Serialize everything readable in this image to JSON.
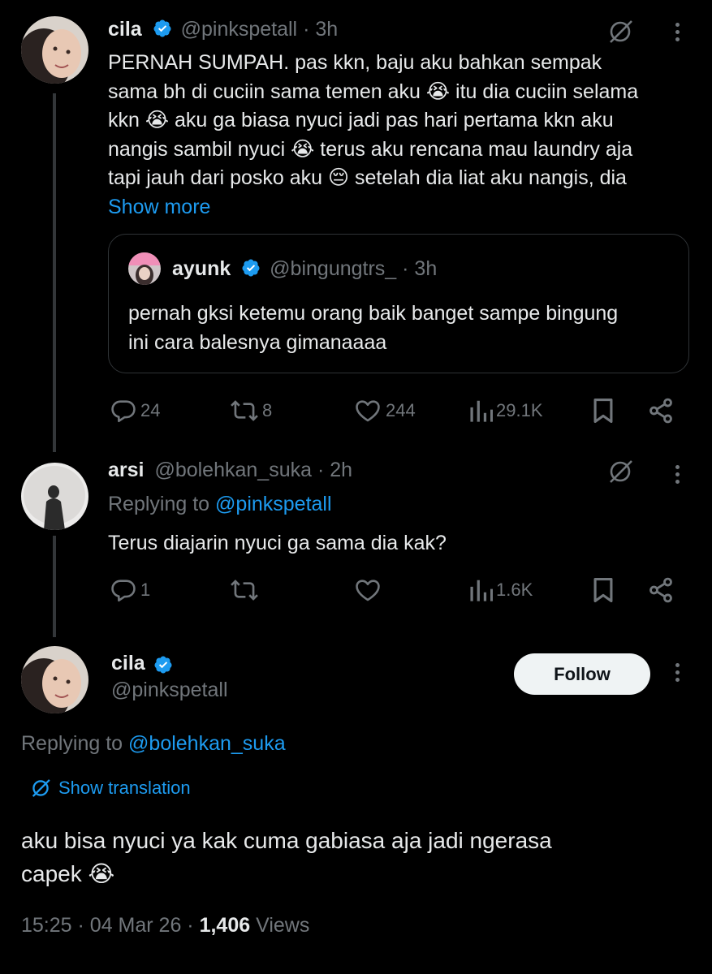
{
  "tweet1": {
    "display_name": "cila",
    "handle": "@pinkspetall",
    "dot_time": "· 3h",
    "lines": [
      "PERNAH SUMPAH. pas kkn, baju aku bahkan sempak",
      "sama bh di cuciin sama temen aku 😭 itu dia cuciin selama",
      "kkn 😭 aku ga biasa nyuci jadi pas hari pertama kkn aku",
      "nangis sambil nyuci 😭 terus aku rencana mau laundry aja",
      "tapi jauh dari posko aku 😔 setelah dia liat aku nangis, dia"
    ],
    "show_more": "Show more",
    "quote": {
      "display_name": "ayunk",
      "handle": "@bingungtrs_",
      "dot_time": "· 3h",
      "lines": [
        "pernah gksi ketemu orang baik banget sampe bingung",
        "ini cara balesnya gimanaaaa"
      ]
    },
    "stats": {
      "replies": "24",
      "reposts": "8",
      "likes": "244",
      "views": "29.1K"
    }
  },
  "tweet2": {
    "display_name": "arsi",
    "handle": "@bolehkan_suka",
    "dot_time": "· 2h",
    "replying_prefix": "Replying to",
    "replying_handle": "@pinkspetall",
    "text": "Terus diajarin nyuci ga sama dia kak?",
    "stats": {
      "replies": "1",
      "reposts": "",
      "likes": "",
      "views": "1.6K"
    }
  },
  "tweet3": {
    "display_name": "cila",
    "handle": "@pinkspetall",
    "follow_label": "Follow",
    "replying_prefix": "Replying to",
    "replying_handle": "@bolehkan_suka",
    "show_translation": "Show translation",
    "lines": [
      "aku bisa nyuci ya kak cuma gabiasa aja jadi ngerasa",
      "capek 😭"
    ],
    "time": "15:25",
    "date": "· 04 Mar 26 ·",
    "views_count": "1,406",
    "views_label": "Views"
  },
  "colors": {
    "background": "#000000",
    "text": "#e7e9ea",
    "muted": "#71767b",
    "accent": "#1d9bf0"
  },
  "icons": [
    "verified-badge-icon",
    "grok-icon",
    "more-icon",
    "reply-icon",
    "repost-icon",
    "like-icon",
    "views-icon",
    "bookmark-icon",
    "share-icon",
    "translate-icon"
  ]
}
